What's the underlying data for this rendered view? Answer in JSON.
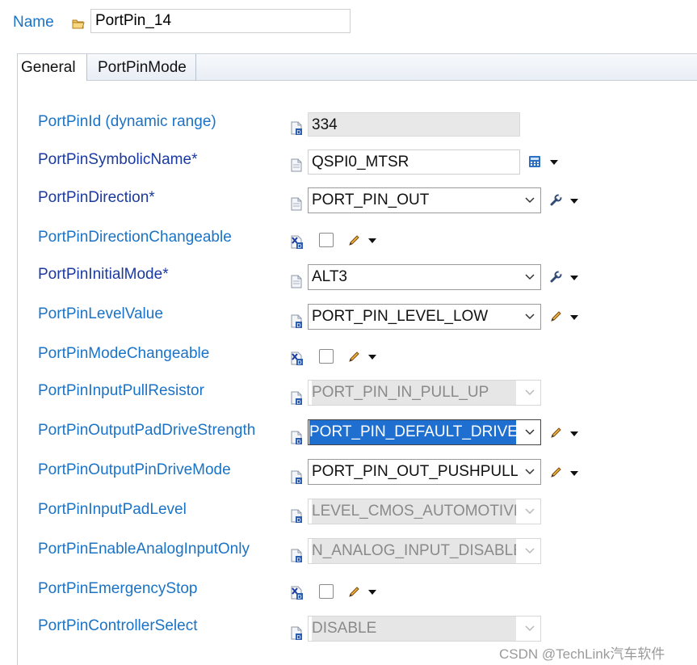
{
  "header": {
    "name_label": "Name",
    "name_value": "PortPin_14"
  },
  "tabs": [
    {
      "label": "General"
    },
    {
      "label": "PortPinMode"
    }
  ],
  "properties": [
    {
      "label": "PortPinId (dynamic range)",
      "value": "334"
    },
    {
      "label": "PortPinSymbolicName*",
      "value": "QSPI0_MTSR"
    },
    {
      "label": "PortPinDirection*",
      "value": "PORT_PIN_OUT"
    },
    {
      "label": "PortPinDirectionChangeable",
      "checked": false
    },
    {
      "label": "PortPinInitialMode*",
      "value": "ALT3"
    },
    {
      "label": "PortPinLevelValue",
      "value": "PORT_PIN_LEVEL_LOW"
    },
    {
      "label": "PortPinModeChangeable",
      "checked": false
    },
    {
      "label": "PortPinInputPullResistor",
      "value": "PORT_PIN_IN_PULL_UP"
    },
    {
      "label": "PortPinOutputPadDriveStrength",
      "value": "PORT_PIN_DEFAULT_DRIVER"
    },
    {
      "label": "PortPinOutputPinDriveMode",
      "value": "PORT_PIN_OUT_PUSHPULL"
    },
    {
      "label": "PortPinInputPadLevel",
      "value": "LEVEL_CMOS_AUTOMOTIVE"
    },
    {
      "label": "PortPinEnableAnalogInputOnly",
      "value": "N_ANALOG_INPUT_DISABLE"
    },
    {
      "label": "PortPinEmergencyStop",
      "checked": false
    },
    {
      "label": "PortPinControllerSelect",
      "value": "DISABLE"
    }
  ],
  "watermark": "CSDN @TechLink汽车软件",
  "colors": {
    "label": "#1a73c6",
    "required_label": "#1a3aa0",
    "selection": "#1f6fd0",
    "readonly_bg": "#e8e8e8"
  }
}
